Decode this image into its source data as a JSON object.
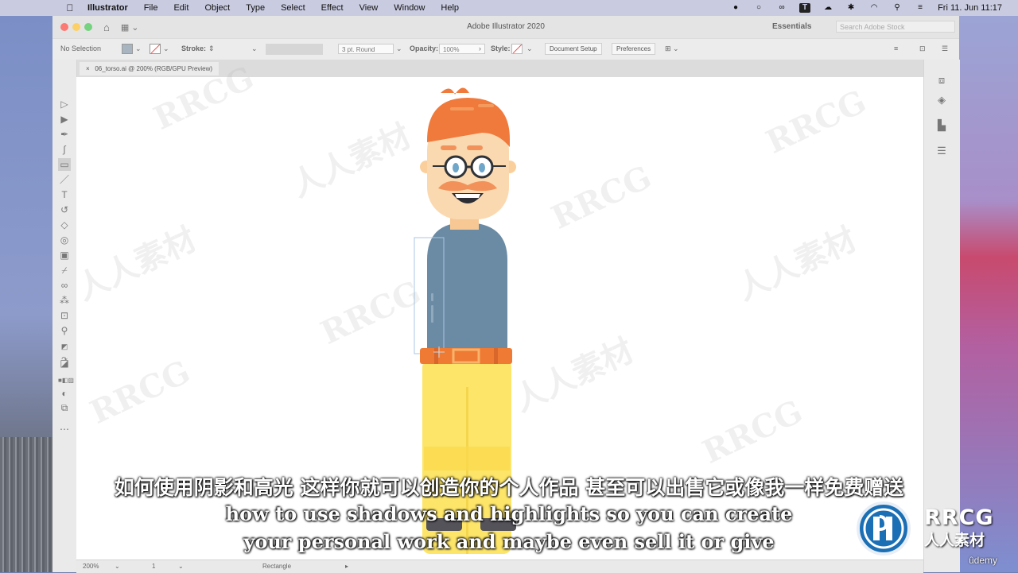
{
  "menubar": {
    "app_name": "Illustrator",
    "items": [
      "File",
      "Edit",
      "Object",
      "Type",
      "Select",
      "Effect",
      "View",
      "Window",
      "Help"
    ],
    "clock": "Fri 11. Jun  11:17"
  },
  "window": {
    "title": "Adobe Illustrator 2020",
    "workspace": "Essentials",
    "search_placeholder": "Search Adobe Stock"
  },
  "control_bar": {
    "selection": "No Selection",
    "stroke_label": "Stroke:",
    "brush": "3 pt. Round",
    "opacity_label": "Opacity:",
    "opacity_value": "100%",
    "style_label": "Style:",
    "document_setup": "Document Setup",
    "preferences": "Preferences"
  },
  "document": {
    "tab": "06_torso.ai @ 200% (RGB/GPU Preview)",
    "close": "×"
  },
  "status_bar": {
    "zoom": "200%",
    "artboard": "1",
    "tool": "Rectangle"
  },
  "watermark": {
    "latin": "RRCG",
    "cjk": "人人素材"
  },
  "subtitles": {
    "chinese": "如何使用阴影和高光 这样你就可以创造你的个人作品 甚至可以出售它或像我一样免费赠送",
    "english_line1": "how to use shadows and highlights so you can create",
    "english_line2": "your personal work and maybe even sell it or give"
  },
  "branding": {
    "rrcg": "RRCG",
    "rrcg_cn": "人人素材",
    "udemy": "ûdemy"
  },
  "colors": {
    "hair": "#f07a3c",
    "skin": "#fbd9b0",
    "shirt": "#6b8aa3",
    "belt": "#ef7a33",
    "pants": "#fce568"
  }
}
